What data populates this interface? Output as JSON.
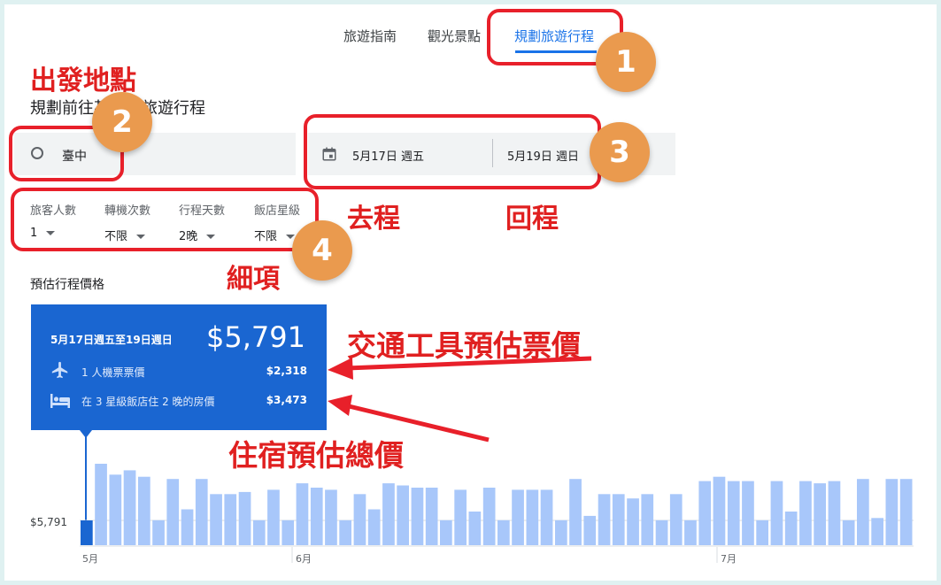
{
  "tabs": [
    {
      "label": "旅遊指南"
    },
    {
      "label": "觀光景點"
    },
    {
      "label": "規劃旅遊行程"
    }
  ],
  "subtitle": "規劃前往某地的旅遊行程",
  "origin": {
    "value": "臺中"
  },
  "dates": {
    "depart": "5月17日 週五",
    "return": "5月19日 週日"
  },
  "options": [
    {
      "label": "旅客人數",
      "value": "1"
    },
    {
      "label": "轉機次數",
      "value": "不限"
    },
    {
      "label": "行程天數",
      "value": "2晚"
    },
    {
      "label": "飯店星級",
      "value": "不限"
    }
  ],
  "price_section_title": "預估行程價格",
  "price_card": {
    "range": "5月17日週五至19日週日",
    "total": "$5,791",
    "flight_label": "1 人機票票價",
    "flight_price": "$2,318",
    "hotel_label": "在 3 星級飯店住 2 晚的房價",
    "hotel_price": "$3,473"
  },
  "annotations": {
    "origin": "出發地點",
    "depart": "去程",
    "return": "回程",
    "details": "細項",
    "transport": "交通工具預估票價",
    "lodging": "住宿預估總價",
    "badges": [
      "1",
      "2",
      "3",
      "4"
    ]
  },
  "colors": {
    "accent": "#1a73e8",
    "card": "#1a66d1",
    "bar": "#a8c7fa",
    "bar_selected": "#1a66d1",
    "annotation": "#e8202a",
    "badge": "#ea9a4e"
  },
  "chart_data": {
    "type": "bar",
    "y_reference_label": "$5,791",
    "x_tick_labels": [
      "5月",
      "6月",
      "7月"
    ],
    "values": [
      5791,
      8400,
      7900,
      8100,
      7800,
      5800,
      7700,
      6300,
      7700,
      7000,
      7000,
      7100,
      5800,
      7200,
      5800,
      7500,
      7300,
      7200,
      5800,
      7000,
      6300,
      7500,
      7400,
      7300,
      7300,
      5800,
      7200,
      6200,
      7300,
      5800,
      7200,
      7200,
      7200,
      5800,
      7700,
      6000,
      7000,
      7000,
      6800,
      7000,
      5800,
      7000,
      5800,
      7600,
      7800,
      7600,
      7600,
      5800,
      7600,
      6200,
      7600,
      7500,
      7600,
      5800,
      7700,
      5900,
      7700,
      7700
    ],
    "selected_index": 0
  }
}
